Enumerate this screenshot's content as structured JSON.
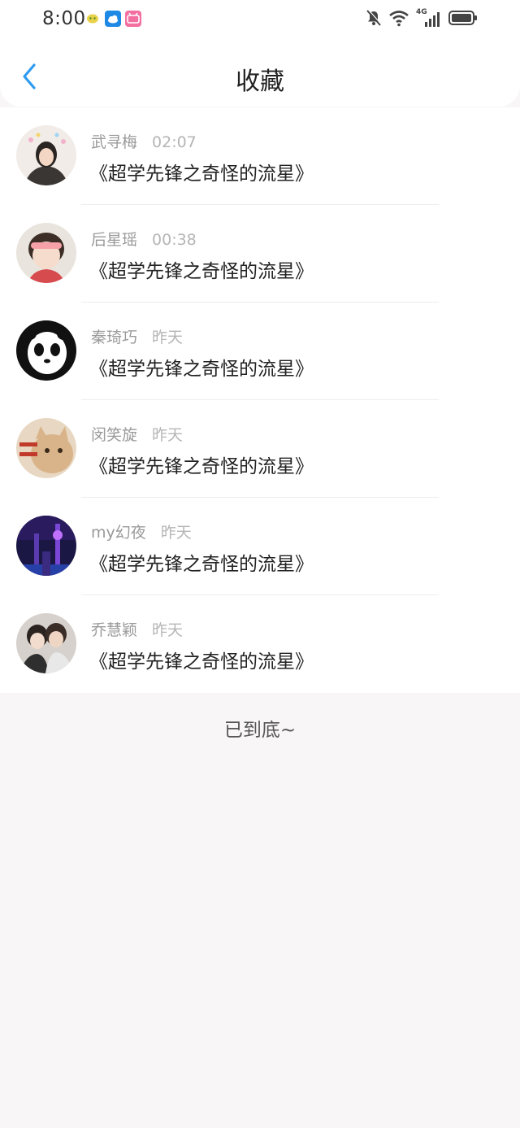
{
  "status_bar": {
    "time": "8:00",
    "network_label": "4G"
  },
  "nav": {
    "title": "收藏",
    "accent_color": "#2e9bf0"
  },
  "favorites": [
    {
      "user": "武寻梅",
      "time": "02:07",
      "title": "《超学先锋之奇怪的流星》"
    },
    {
      "user": "后星瑶",
      "time": "00:38",
      "title": "《超学先锋之奇怪的流星》"
    },
    {
      "user": "秦琦巧",
      "time": "昨天",
      "title": "《超学先锋之奇怪的流星》"
    },
    {
      "user": "闵笑旋",
      "time": "昨天",
      "title": "《超学先锋之奇怪的流星》"
    },
    {
      "user": "my幻夜",
      "time": "昨天",
      "title": "《超学先锋之奇怪的流星》"
    },
    {
      "user": "乔慧颖",
      "time": "昨天",
      "title": "《超学先锋之奇怪的流星》"
    }
  ],
  "footer": {
    "end_text": "已到底~"
  }
}
